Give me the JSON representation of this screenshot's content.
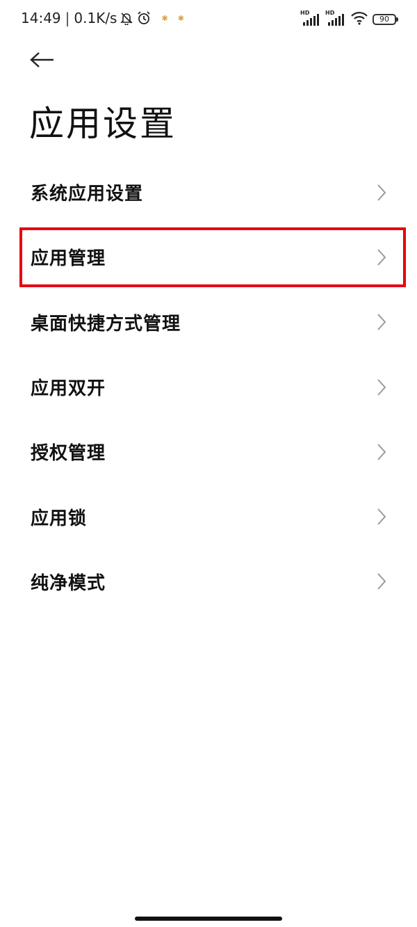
{
  "status_bar": {
    "time": "14:49",
    "separator": "|",
    "net_speed": "0.1K/s",
    "icons": [
      "bell-muted-icon",
      "alarm-icon",
      "notification-dot-icon",
      "notification-dot-icon"
    ],
    "right_icons": [
      "hd-signal-icon",
      "hd-signal-icon",
      "wifi-icon"
    ],
    "hd_label": "HD",
    "battery_level": "90"
  },
  "header": {
    "back_icon": "arrow-left-icon",
    "title": "应用设置"
  },
  "menu": {
    "items": [
      {
        "label": "系统应用设置",
        "icon": "chevron-right-icon"
      },
      {
        "label": "应用管理",
        "icon": "chevron-right-icon",
        "highlighted": true
      },
      {
        "label": "桌面快捷方式管理",
        "icon": "chevron-right-icon"
      },
      {
        "label": "应用双开",
        "icon": "chevron-right-icon"
      },
      {
        "label": "授权管理",
        "icon": "chevron-right-icon"
      },
      {
        "label": "应用锁",
        "icon": "chevron-right-icon"
      },
      {
        "label": "纯净模式",
        "icon": "chevron-right-icon"
      }
    ]
  },
  "colors": {
    "highlight_border": "#e60012",
    "chevron": "#9a9a9a",
    "text": "#111111",
    "background": "#ffffff"
  }
}
